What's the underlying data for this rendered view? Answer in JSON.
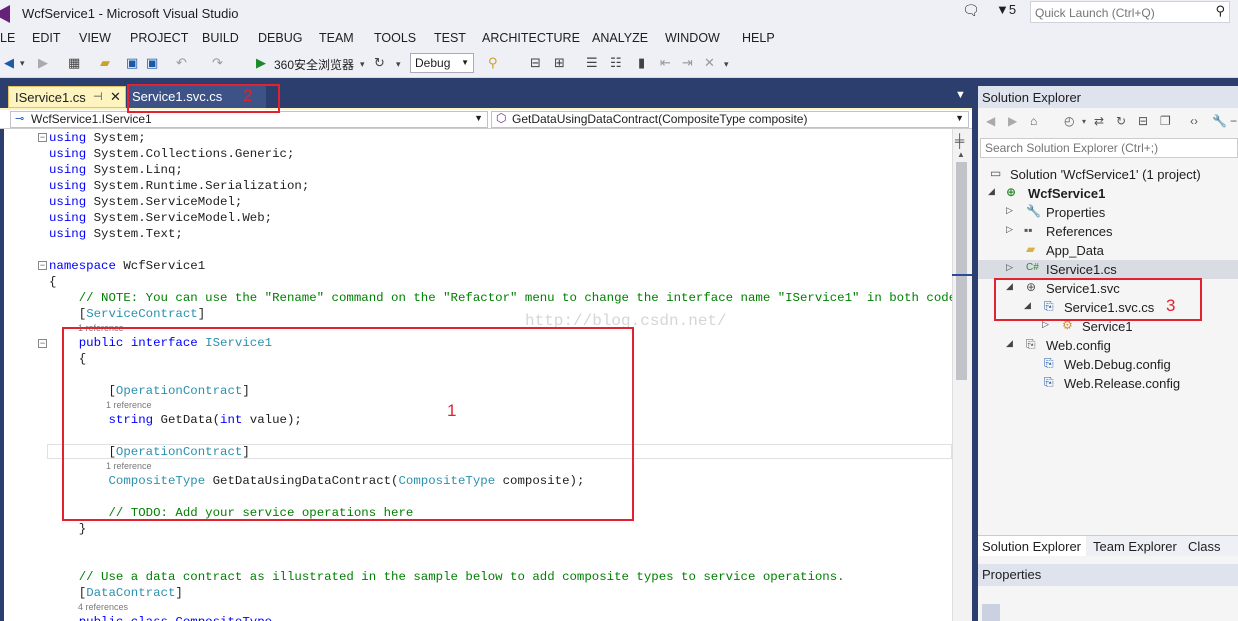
{
  "window": {
    "title": "WcfService1 - Microsoft Visual Studio",
    "notification_count": "5",
    "quick_launch_placeholder": "Quick Launch (Ctrl+Q)"
  },
  "menu": [
    "LE",
    "EDIT",
    "VIEW",
    "PROJECT",
    "BUILD",
    "DEBUG",
    "TEAM",
    "TOOLS",
    "TEST",
    "ARCHITECTURE",
    "ANALYZE",
    "WINDOW",
    "HELP"
  ],
  "toolbar": {
    "run_target": "360安全浏览器",
    "configuration": "Debug"
  },
  "tabs": [
    {
      "label": "IService1.cs",
      "pin": "⊣",
      "close": "✕"
    },
    {
      "label": "Service1.svc.cs"
    }
  ],
  "navbar": {
    "left": "WcfService1.IService1",
    "right": "GetDataUsingDataContract(CompositeType composite)"
  },
  "code_lines": {
    "using_kw": "using",
    "using": [
      " System;",
      " System.Collections.Generic;",
      " System.Linq;",
      " System.Runtime.Serialization;",
      " System.ServiceModel;",
      " System.ServiceModel.Web;",
      " System.Text;"
    ],
    "namespace_kw": "namespace",
    "namespace_name": " WcfService1",
    "brace_open": "{",
    "brace_close": "}",
    "note_comment": "    // NOTE: You can use the \"Rename\" command on the \"Refactor\" menu to change the interface name \"IService1\" in both code and co",
    "service_contract": "ServiceContract",
    "lens_1ref": "1 reference",
    "public_kw": "public",
    "interface_kw": "interface",
    "interface_name": "IService1",
    "operation_contract": "OperationContract",
    "string_kw": "string",
    "getdata": " GetData(",
    "int_kw": "int",
    "getdata_rest": " value);",
    "composite_type": "CompositeType",
    "getdatadc": " GetDataUsingDataContract(",
    "getdatadc_rest": " composite);",
    "todo_comment": "// TODO: Add your service operations here",
    "use_contract_comment": "// Use a data contract as illustrated in the sample below to add composite types to service operations.",
    "data_contract": "DataContract",
    "lens_4ref": "4 references",
    "public_class": "public class CompositeType"
  },
  "watermark": "http://blog.csdn.net/",
  "solution_explorer": {
    "title": "Solution Explorer",
    "search_placeholder": "Search Solution Explorer (Ctrl+;)",
    "tree": [
      {
        "label": "Solution 'WcfService1' (1 project)",
        "icon": "solution-icon",
        "bold": false
      },
      {
        "label": "WcfService1",
        "icon": "project-icon",
        "bold": true
      },
      {
        "label": "Properties",
        "icon": "wrench-icon",
        "bold": false
      },
      {
        "label": "References",
        "icon": "references-icon",
        "bold": false
      },
      {
        "label": "App_Data",
        "icon": "folder-icon",
        "bold": false
      },
      {
        "label": "IService1.cs",
        "icon": "csharp-file-icon",
        "bold": false
      },
      {
        "label": "Service1.svc",
        "icon": "svc-file-icon",
        "bold": false
      },
      {
        "label": "Service1.svc.cs",
        "icon": "code-file-icon",
        "bold": false
      },
      {
        "label": "Service1",
        "icon": "class-icon",
        "bold": false
      },
      {
        "label": "Web.config",
        "icon": "config-file-icon",
        "bold": false
      },
      {
        "label": "Web.Debug.config",
        "icon": "config-file-icon",
        "bold": false
      },
      {
        "label": "Web.Release.config",
        "icon": "config-file-icon",
        "bold": false
      }
    ],
    "bottom_tabs": [
      "Solution Explorer",
      "Team Explorer",
      "Class Vie"
    ]
  },
  "properties": {
    "title": "Properties"
  },
  "annotations": {
    "box1": "1",
    "box2": "2",
    "box3": "3"
  },
  "colors": {
    "accent_dark": "#2c3e6e",
    "active_tab": "#fdf4bf",
    "annotation_red": "#e0232e",
    "keyword": "#0000ff",
    "type": "#2b91af",
    "comment": "#008000"
  }
}
